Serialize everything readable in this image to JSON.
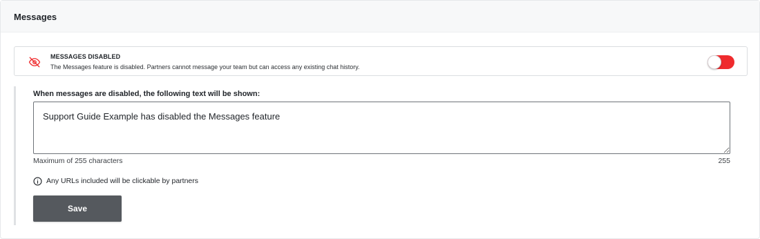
{
  "header": {
    "title": "Messages"
  },
  "banner": {
    "icon": "eye-off-icon",
    "icon_color": "#ef2b2d",
    "title": "MESSAGES DISABLED",
    "description": "The Messages feature is disabled. Partners cannot message your team but can access any existing chat history.",
    "toggle": {
      "enabled": false,
      "track_color": "#ef2b2d"
    }
  },
  "form": {
    "label": "When messages are disabled, the following text will be shown:",
    "message_value": "Support Guide Example has disabled the Messages feature",
    "hint": "Maximum of 255 characters",
    "remaining": "255",
    "info_icon": "info-icon",
    "info_text": "Any URLs included will be clickable by partners",
    "save_label": "Save",
    "save_color": "#55595e"
  }
}
